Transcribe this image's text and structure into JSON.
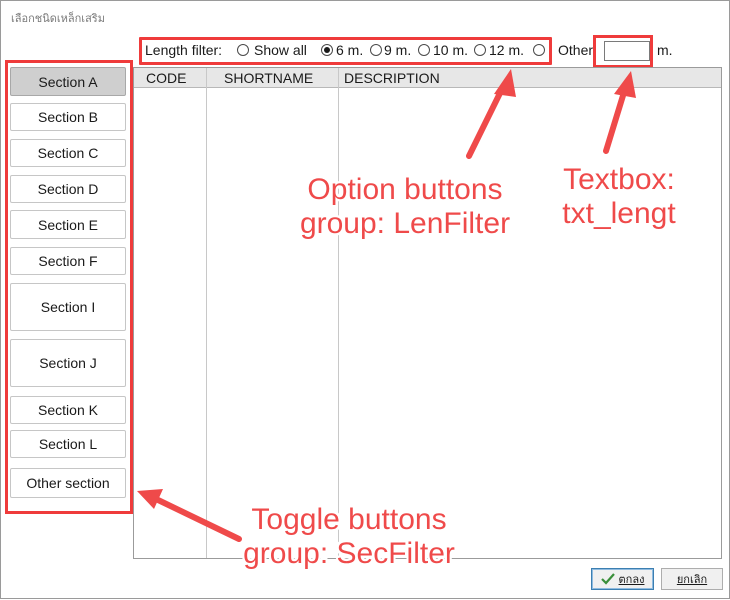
{
  "window": {
    "title": "เลือกชนิดเหล็กเสริม"
  },
  "length_filter": {
    "label": "Length filter:",
    "options": [
      "Show all",
      "6 m.",
      "9 m.",
      "10 m.",
      "12 m.",
      ""
    ],
    "selected": "6 m.",
    "other_label": "Other:",
    "other_value": "",
    "other_unit": "m."
  },
  "table": {
    "columns": [
      "CODE",
      "SHORTNAME",
      "DESCRIPTION"
    ],
    "rows": []
  },
  "sections": {
    "items": [
      "Section A",
      "Section B",
      "Section C",
      "Section D",
      "Section E",
      "Section F",
      "Section I",
      "Section J",
      "Section K",
      "Section L",
      "Other section"
    ],
    "active": "Section A"
  },
  "annotations": {
    "option_buttons": [
      "Option buttons",
      "group: LenFilter"
    ],
    "textbox": [
      "Textbox:",
      "txt_lengt"
    ],
    "toggle_buttons": [
      "Toggle buttons",
      "group: SecFilter"
    ]
  },
  "buttons": {
    "ok_label": "ตกลง",
    "cancel_label": "ยกเลิก"
  },
  "colors": {
    "annotation": "#ef4a4a",
    "ok_check": "#3a8f3a"
  }
}
